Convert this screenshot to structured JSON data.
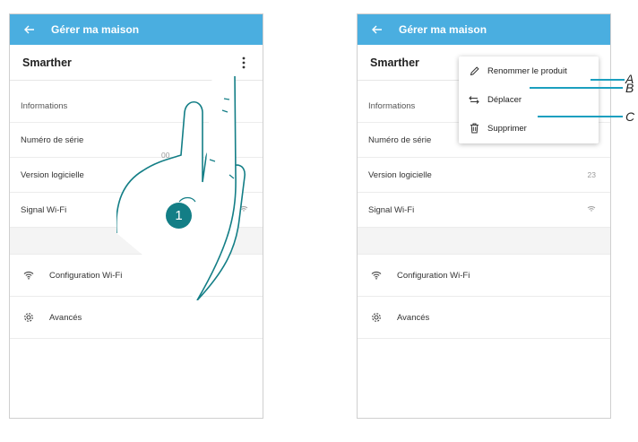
{
  "header": {
    "title": "Gérer ma maison"
  },
  "product": {
    "name": "Smarther"
  },
  "info": {
    "section_label": "Informations",
    "rows": [
      {
        "label": "Numéro de série",
        "value_left": "00",
        "value_right": ""
      },
      {
        "label": "Version logicielle",
        "value_left": "",
        "value_right": "23"
      },
      {
        "label": "Signal Wi-Fi",
        "value_left": "",
        "value_right": ""
      }
    ]
  },
  "menu": {
    "wifi_config": "Configuration Wi-Fi",
    "advanced": "Avancés"
  },
  "dropdown": {
    "rename": "Renommer le produit",
    "move": "Déplacer",
    "delete": "Supprimer"
  },
  "callouts": {
    "a": "A",
    "b": "B",
    "c": "C"
  },
  "step": {
    "number": "1"
  },
  "colors": {
    "header": "#4aaee0",
    "callout": "#1b9fbf",
    "badge": "#137e86"
  },
  "icons": {
    "back": "arrow-left-icon",
    "more": "kebab-menu-icon",
    "wifi": "wifi-icon",
    "settings": "gear-icon",
    "rename": "pencil-icon",
    "move": "swap-arrows-icon",
    "delete": "trash-icon"
  }
}
